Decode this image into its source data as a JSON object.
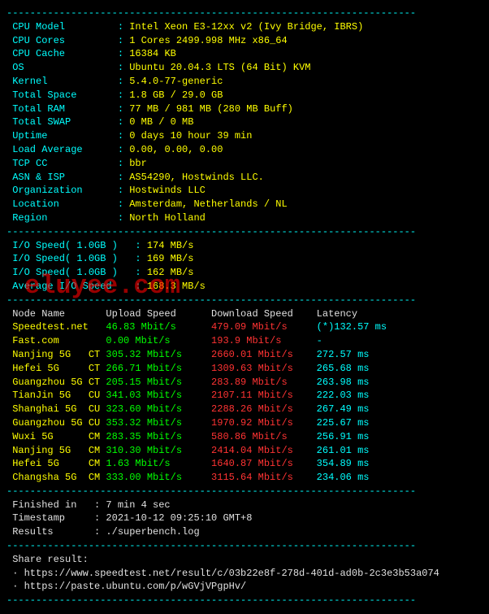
{
  "divider": "----------------------------------------------------------------------",
  "sys": [
    {
      "label": "CPU Model",
      "value": "Intel Xeon E3-12xx v2 (Ivy Bridge, IBRS)"
    },
    {
      "label": "CPU Cores",
      "value": "1 Cores 2499.998 MHz x86_64"
    },
    {
      "label": "CPU Cache",
      "value": "16384 KB"
    },
    {
      "label": "OS",
      "value": "Ubuntu 20.04.3 LTS (64 Bit) KVM"
    },
    {
      "label": "Kernel",
      "value": "5.4.0-77-generic"
    },
    {
      "label": "Total Space",
      "value": "1.8 GB / 29.0 GB"
    },
    {
      "label": "Total RAM",
      "value": "77 MB / 981 MB (280 MB Buff)"
    },
    {
      "label": "Total SWAP",
      "value": "0 MB / 0 MB"
    },
    {
      "label": "Uptime",
      "value": "0 days 10 hour 39 min"
    },
    {
      "label": "Load Average",
      "value": "0.00, 0.00, 0.00"
    },
    {
      "label": "TCP CC",
      "value": "bbr"
    },
    {
      "label": "ASN & ISP",
      "value": "AS54290, Hostwinds LLC."
    },
    {
      "label": "Organization",
      "value": "Hostwinds LLC"
    },
    {
      "label": "Location",
      "value": "Amsterdam, Netherlands / NL"
    },
    {
      "label": "Region",
      "value": "North Holland"
    }
  ],
  "io": [
    {
      "label": "I/O Speed( 1.0GB )",
      "value": "174 MB/s"
    },
    {
      "label": "I/O Speed( 1.0GB )",
      "value": "169 MB/s"
    },
    {
      "label": "I/O Speed( 1.0GB )",
      "value": "162 MB/s"
    },
    {
      "label": "Average I/O Speed",
      "value": "168.3 MB/s"
    }
  ],
  "speedtest_header": {
    "node": "Node Name",
    "upload": "Upload Speed",
    "download": "Download Speed",
    "latency": "Latency"
  },
  "speedtests": [
    {
      "node": "Speedtest.net",
      "up": "46.83 Mbit/s",
      "down": "479.09 Mbit/s",
      "lat": "(*)132.57 ms"
    },
    {
      "node": "Fast.com",
      "up": "0.00 Mbit/s",
      "down": "193.9 Mbit/s",
      "lat": "-"
    },
    {
      "node": "Nanjing 5G   CT",
      "up": "305.32 Mbit/s",
      "down": "2660.01 Mbit/s",
      "lat": "272.57 ms"
    },
    {
      "node": "Hefei 5G     CT",
      "up": "266.71 Mbit/s",
      "down": "1309.63 Mbit/s",
      "lat": "265.68 ms"
    },
    {
      "node": "Guangzhou 5G CT",
      "up": "205.15 Mbit/s",
      "down": "283.89 Mbit/s",
      "lat": "263.98 ms"
    },
    {
      "node": "TianJin 5G   CU",
      "up": "341.03 Mbit/s",
      "down": "2107.11 Mbit/s",
      "lat": "222.03 ms"
    },
    {
      "node": "Shanghai 5G  CU",
      "up": "323.60 Mbit/s",
      "down": "2288.26 Mbit/s",
      "lat": "267.49 ms"
    },
    {
      "node": "Guangzhou 5G CU",
      "up": "353.32 Mbit/s",
      "down": "1970.92 Mbit/s",
      "lat": "225.67 ms"
    },
    {
      "node": "Wuxi 5G      CM",
      "up": "283.35 Mbit/s",
      "down": "580.86 Mbit/s",
      "lat": "256.91 ms"
    },
    {
      "node": "Nanjing 5G   CM",
      "up": "310.30 Mbit/s",
      "down": "2414.04 Mbit/s",
      "lat": "261.01 ms"
    },
    {
      "node": "Hefei 5G     CM",
      "up": "1.63 Mbit/s",
      "down": "1640.87 Mbit/s",
      "lat": "354.89 ms"
    },
    {
      "node": "Changsha 5G  CM",
      "up": "333.00 Mbit/s",
      "down": "3115.64 Mbit/s",
      "lat": "234.06 ms"
    }
  ],
  "footer": [
    {
      "label": "Finished in",
      "value": "7 min 4 sec"
    },
    {
      "label": "Timestamp",
      "value": "2021-10-12 09:25:10 GMT+8"
    },
    {
      "label": "Results",
      "value": "./superbench.log"
    }
  ],
  "share": {
    "heading": "Share result:",
    "links": [
      "https://www.speedtest.net/result/c/03b22e8f-278d-401d-ad0b-2c3e3b53a074",
      "https://paste.ubuntu.com/p/wGVjVPgpHv/"
    ]
  },
  "watermark": "eluyee.com"
}
